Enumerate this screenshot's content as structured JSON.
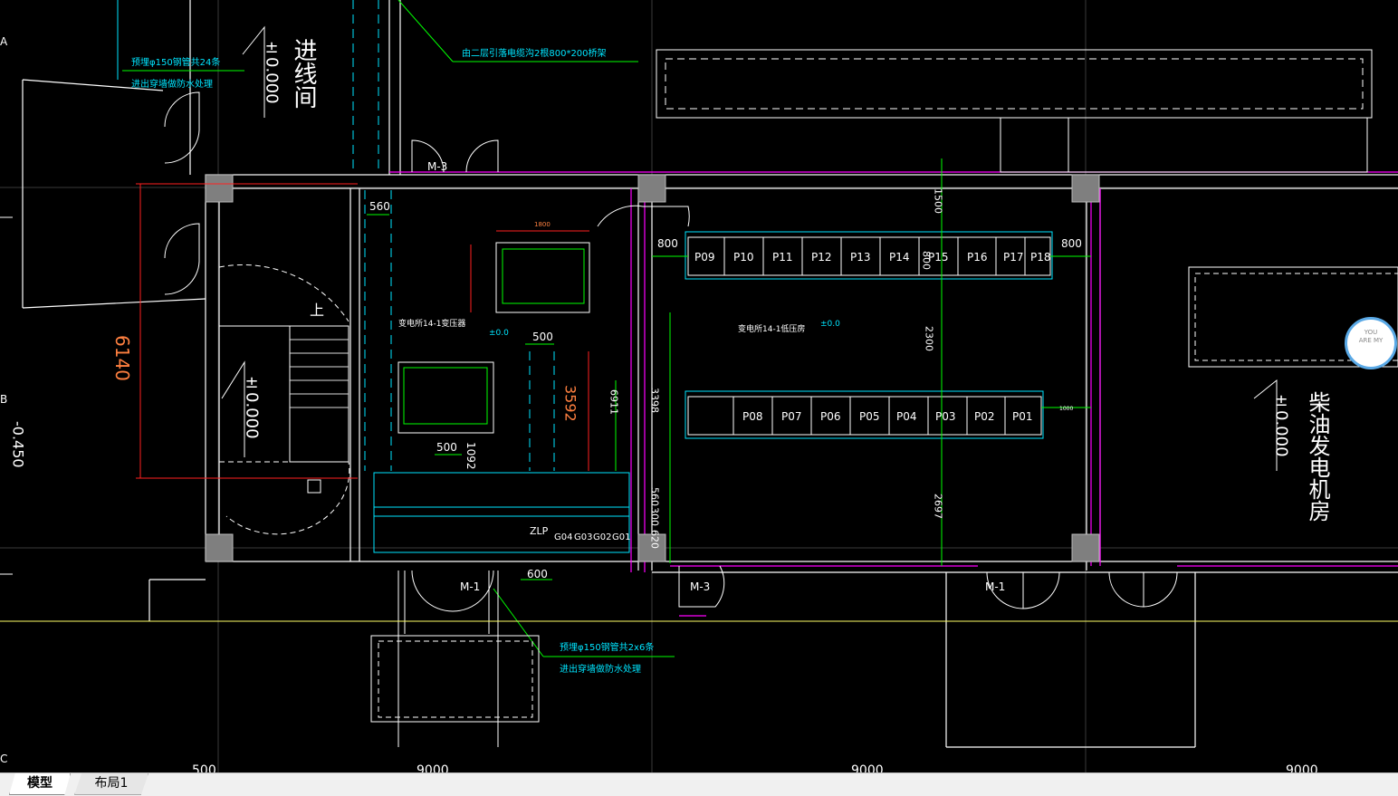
{
  "tabs": [
    {
      "label": "模型",
      "active": true
    },
    {
      "label": "布局1",
      "active": false
    }
  ],
  "grid_labels": {
    "a": "A",
    "b": "B",
    "c": "C"
  },
  "rooms": {
    "incoming": "进线间",
    "substation": "变电所14-1变压器",
    "low_voltage": "变电所14-1低压房",
    "generator": "柴油发电机房"
  },
  "elevations": {
    "zero_left_top": "±0.000",
    "zero_left_mid": "±0.000",
    "zero_right": "±0.000",
    "minus": "-0.450",
    "small_zero": "±0.0"
  },
  "notes": {
    "note1_line1": "预埋φ150钢管共24条",
    "note1_line2": "进出穿墙做防水处理",
    "note2": "由二层引落电缆沟2根800*200桥架",
    "note3_line1": "预埋φ150钢管共2x6条",
    "note3_line2": "进出穿墙做防水处理"
  },
  "doors": {
    "m3_top": "M-3",
    "m3_bottom": "M-3",
    "m1_left": "M-1",
    "m1_right": "M-1",
    "zlp": "ZLP"
  },
  "dims": {
    "d6140": "6140",
    "d560": "560",
    "d1800": "1800",
    "d1500": "500",
    "d3592": "3592",
    "d500": "500",
    "d1092": "1092",
    "d600": "600",
    "d6911": "6911",
    "d800l": "800",
    "d800r": "800",
    "d3398": "3398",
    "d560b": "560",
    "d300": "300",
    "d620": "620",
    "d1500v": "1500",
    "d2300": "2300",
    "d2697": "2697",
    "d800m": "800",
    "d1000": "1000",
    "bottom1": "500",
    "bottom2": "9000",
    "bottom3": "9000",
    "bottom4": "9000",
    "stair_up": "上"
  },
  "panels_top": [
    "P09",
    "P10",
    "P11",
    "P12",
    "P13",
    "P14",
    "P15",
    "P16",
    "P17",
    "P18"
  ],
  "panels_bottom": [
    "P08",
    "P07",
    "P06",
    "P05",
    "P04",
    "P03",
    "P02",
    "P01"
  ],
  "gen_panels": [
    "G04",
    "G03",
    "G02",
    "G01"
  ],
  "colors": {
    "wall": "#ffffff",
    "column": "#808080",
    "accent": "#ff00ff",
    "cyan": "#00e5ff",
    "green": "#00ff00",
    "red": "#ff2020",
    "yellow": "#ffff66",
    "orange": "#ff8040"
  },
  "watermark": {
    "line1": "YOU",
    "line2": "ARE MY"
  }
}
